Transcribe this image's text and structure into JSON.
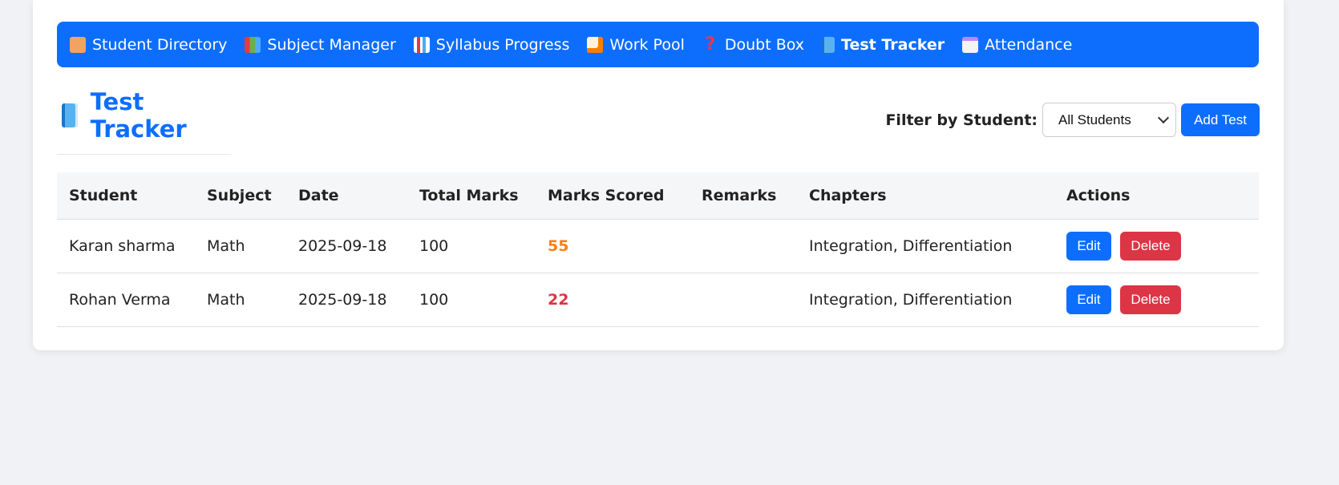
{
  "nav": {
    "items": [
      {
        "label": "Student Directory",
        "icon": "school-icon",
        "color": "#f4a261"
      },
      {
        "label": "Subject Manager",
        "icon": "books-icon",
        "color": "#6ab04c"
      },
      {
        "label": "Syllabus Progress",
        "icon": "bar-chart-icon",
        "color": "#e9ecef"
      },
      {
        "label": "Work Pool",
        "icon": "memo-icon",
        "color": "#ffd6a5"
      },
      {
        "label": "Doubt Box",
        "icon": "question-icon",
        "color": "#e63946"
      },
      {
        "label": "Test Tracker",
        "icon": "book-icon",
        "color": "#4dabf7",
        "active": true
      },
      {
        "label": "Attendance",
        "icon": "calendar-icon",
        "color": "#e9ecef"
      }
    ]
  },
  "page": {
    "title": "Test Tracker",
    "title_color": "#0d6efd"
  },
  "filter": {
    "label": "Filter by Student:",
    "selected": "All Students"
  },
  "add_button": "Add Test",
  "table": {
    "headers": [
      "Student",
      "Subject",
      "Date",
      "Total Marks",
      "Marks Scored",
      "Remarks",
      "Chapters",
      "Actions"
    ],
    "rows": [
      {
        "student": "Karan sharma",
        "subject": "Math",
        "date": "2025-09-18",
        "total": "100",
        "scored": "55",
        "remarks": "",
        "chapters": "Integration, Differentiation"
      },
      {
        "student": "Rohan Verma",
        "subject": "Math",
        "date": "2025-09-18",
        "total": "100",
        "scored": "22",
        "remarks": "",
        "chapters": "Integration, Differentiation"
      }
    ],
    "edit_label": "Edit",
    "delete_label": "Delete"
  },
  "colors": {
    "primary": "#0d6efd",
    "danger": "#dc3545",
    "warning": "#fd7e14"
  }
}
